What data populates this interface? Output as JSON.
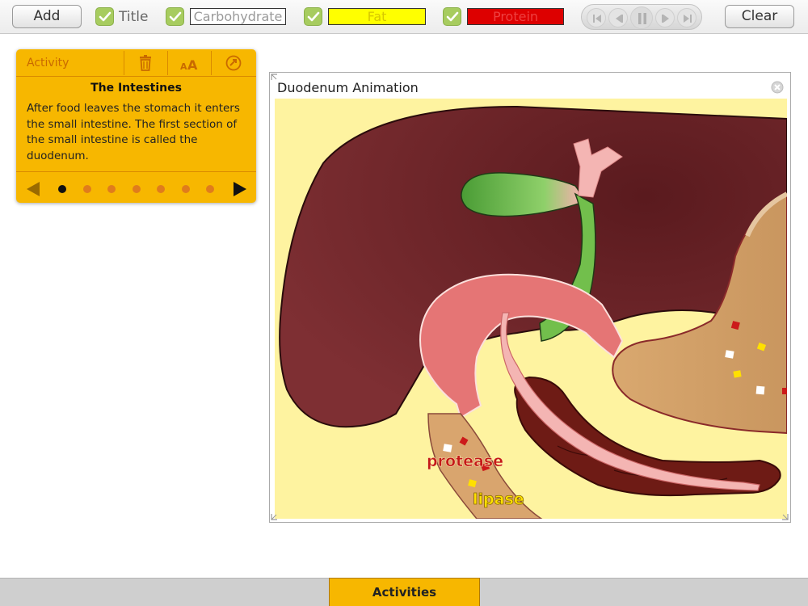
{
  "toolbar": {
    "add_label": "Add",
    "clear_label": "Clear",
    "toggles": {
      "title_label": "Title",
      "carbohydrate_label": "Carbohydrate",
      "fat_label": "Fat",
      "protein_label": "Protein"
    },
    "colors": {
      "check": "#a7cc5f",
      "fat": "#ffff00",
      "protein": "#dd0000"
    }
  },
  "activity": {
    "header_label": "Activity",
    "title": "The Intestines",
    "body": "After food leaves the stomach it enters the small intestine. The first section of the small intestine is called the duodenum.",
    "current_step": 1,
    "total_steps": 7
  },
  "animation": {
    "title": "Duodenum Animation",
    "labels": {
      "protease": "protease",
      "lipase": "lipase"
    }
  },
  "bottom": {
    "activities_tab": "Activities"
  }
}
